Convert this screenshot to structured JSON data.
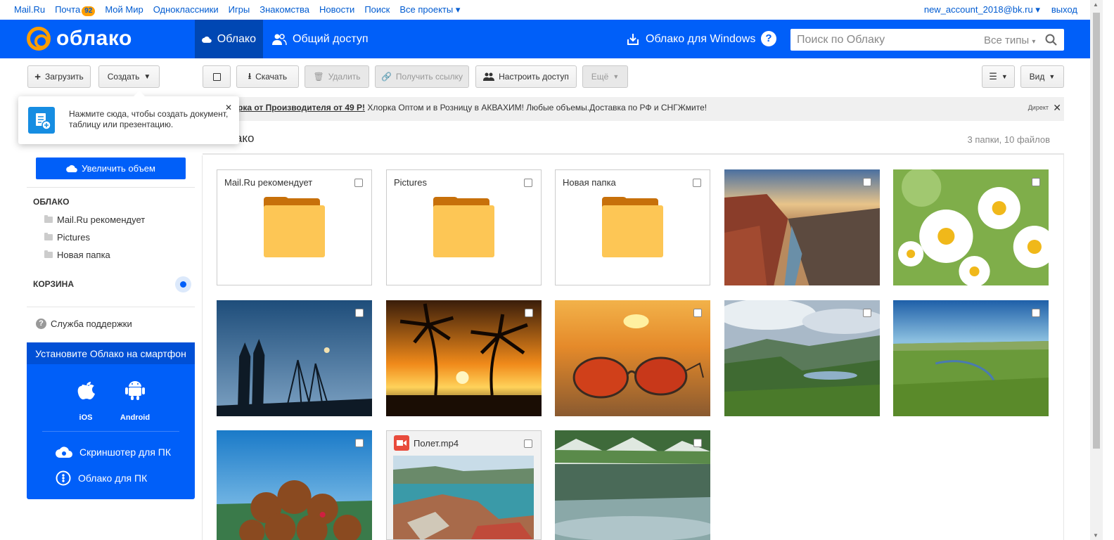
{
  "portal": {
    "nav": [
      "Mail.Ru",
      "Почта",
      "Мой Мир",
      "Одноклассники",
      "Игры",
      "Знакомства",
      "Новости",
      "Поиск",
      "Все проекты"
    ],
    "mail_badge": "92",
    "account": "new_account_2018@bk.ru",
    "logout": "выход"
  },
  "header": {
    "logo_text": "облако",
    "tabs": [
      "Облако",
      "Общий доступ"
    ],
    "windows_app": "Облако для Windows",
    "help": "?",
    "search_placeholder": "Поиск по Облаку",
    "search_types": "Все типы"
  },
  "toolbar": {
    "upload": "Загрузить",
    "create": "Создать",
    "download": "Скачать",
    "delete": "Удалить",
    "get_link": "Получить ссылку",
    "setup_access": "Настроить доступ",
    "more": "Ещё",
    "view": "Вид"
  },
  "tooltip": {
    "text": "Нажмите сюда, чтобы создать документ, таблицу или презентацию."
  },
  "sidebar": {
    "upgrade": "Увеличить объем",
    "cloud_heading": "ОБЛАКО",
    "folders": [
      "Mail.Ru рекомендует",
      "Pictures",
      "Новая папка"
    ],
    "trash_heading": "КОРЗИНА",
    "support": "Служба поддержки"
  },
  "promo": {
    "title": "Установите Облако на смартфон",
    "ios": "iOS",
    "android": "Android",
    "screenshoter": "Скриншотер для ПК",
    "pc_app": "Облако для ПК"
  },
  "ad": {
    "bold": "рка от Производителя от 49 Р!",
    "text": " Хлорка Оптом и в Розницу в АКВАХИМ! Любые объемы.Доставка по РФ и СНГЖмите!",
    "label": "Директ"
  },
  "content": {
    "title": "лако",
    "count": "3 папки, 10 файлов"
  },
  "tiles": {
    "folders": [
      "Mail.Ru рекомендует",
      "Pictures",
      "Новая папка"
    ],
    "video_name": "Полет.mp4"
  },
  "colors": {
    "brand_blue": "#005ff9",
    "accent_orange": "#ff9e00",
    "folder_yellow": "#fdc655"
  }
}
